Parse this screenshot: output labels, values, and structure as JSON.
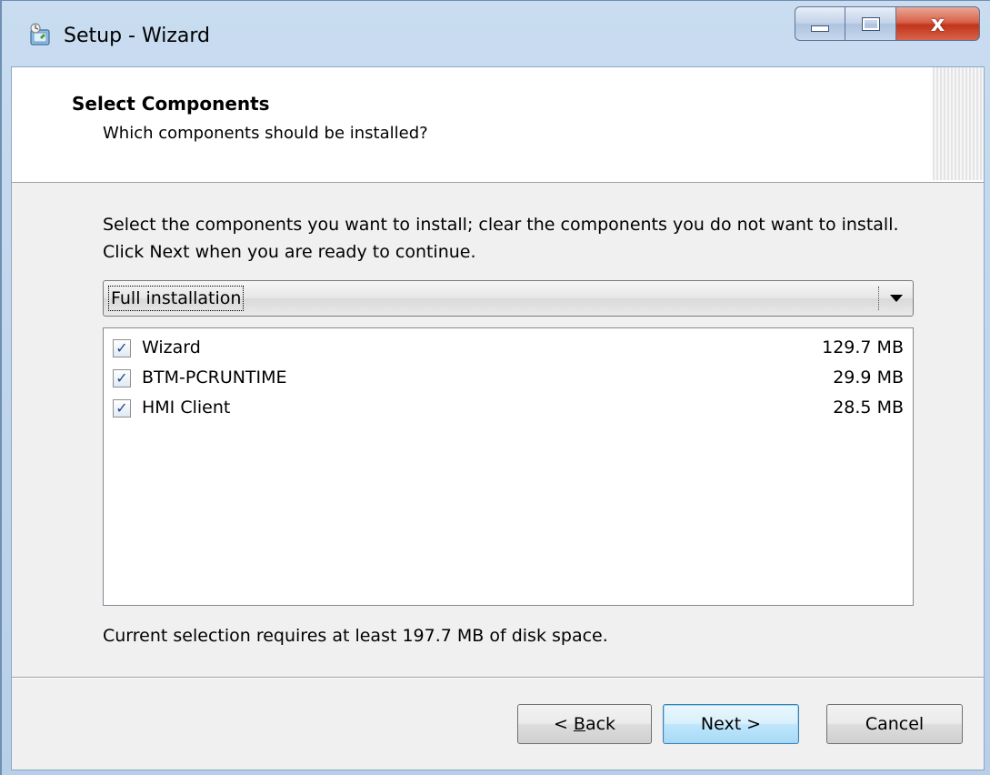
{
  "window": {
    "title": "Setup - Wizard",
    "icon": "setup-app-icon",
    "caption_buttons": {
      "minimize": "minimize",
      "maximize": "maximize",
      "close": "x"
    }
  },
  "header": {
    "title": "Select Components",
    "subtitle": "Which components should be installed?"
  },
  "instructions": "Select the components you want to install; clear the components you do not want to install. Click Next when you are ready to continue.",
  "setup_type": {
    "selected": "Full installation"
  },
  "components": [
    {
      "name": "Wizard",
      "size": "129.7 MB",
      "checked": true
    },
    {
      "name": "BTM-PCRUNTIME",
      "size": "29.9 MB",
      "checked": true
    },
    {
      "name": "HMI Client",
      "size": "28.5 MB",
      "checked": true
    }
  ],
  "disk_note": "Current selection requires at least 197.7 MB of disk space.",
  "buttons": {
    "back_prefix": "< ",
    "back_accel": "B",
    "back_rest": "ack",
    "next": "Next >",
    "cancel": "Cancel"
  },
  "colors": {
    "titlebar": "#b7cfe8",
    "close_button": "#c2341c",
    "default_button_border": "#3c7fb1",
    "check_mark": "#224a8c"
  }
}
